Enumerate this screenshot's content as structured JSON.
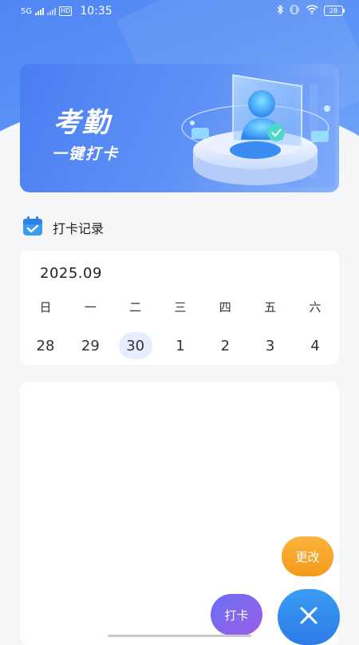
{
  "status_bar": {
    "network": "5G",
    "hd_badge": "HD",
    "time": "10:35",
    "battery": "28"
  },
  "banner": {
    "title": "考勤",
    "subtitle": "一键打卡"
  },
  "section": {
    "title": "打卡记录"
  },
  "calendar": {
    "month": "2025.09",
    "weekdays": [
      "日",
      "一",
      "二",
      "三",
      "四",
      "五",
      "六"
    ],
    "dates": [
      "28",
      "29",
      "30",
      "1",
      "2",
      "3",
      "4"
    ],
    "selected_date": "30"
  },
  "actions": {
    "edit_label": "更改",
    "punch_label": "打卡"
  },
  "colors": {
    "primary": "#4f86f4",
    "accent_orange": "#f49a1c",
    "accent_purple": "#8b63ea",
    "selected_bg": "#e6edfd"
  }
}
